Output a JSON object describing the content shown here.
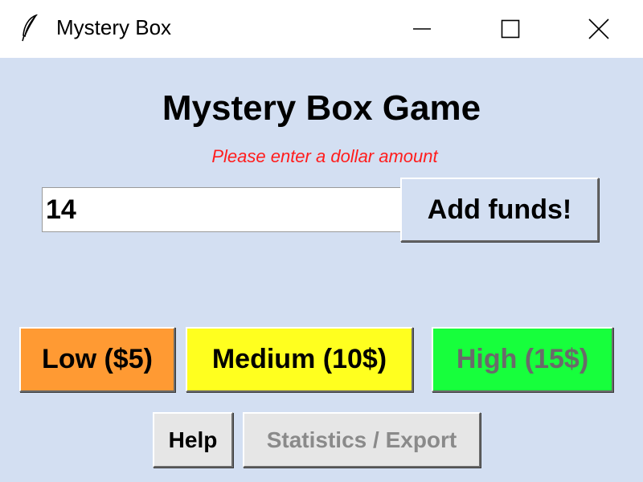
{
  "window": {
    "title": "Mystery Box",
    "icon": "feather-icon",
    "controls": [
      "minimize-icon",
      "maximize-icon",
      "close-icon"
    ]
  },
  "main": {
    "heading": "Mystery Box Game",
    "error_message": "Please enter a dollar amount",
    "amount_input_value": "14",
    "add_funds_label": "Add funds!"
  },
  "box_buttons": {
    "low_label": "Low ($5)",
    "medium_label": "Medium (10$)",
    "high_label": "High (15$)"
  },
  "footer_buttons": {
    "help_label": "Help",
    "stats_label": "Statistics / Export"
  },
  "colors": {
    "background": "#d3dff2",
    "error_text": "#ff1d1d",
    "low_button": "#ff9a33",
    "medium_button": "#ffff1f",
    "high_button": "#17ff3c",
    "disabled_text": "#8a8a8a"
  }
}
